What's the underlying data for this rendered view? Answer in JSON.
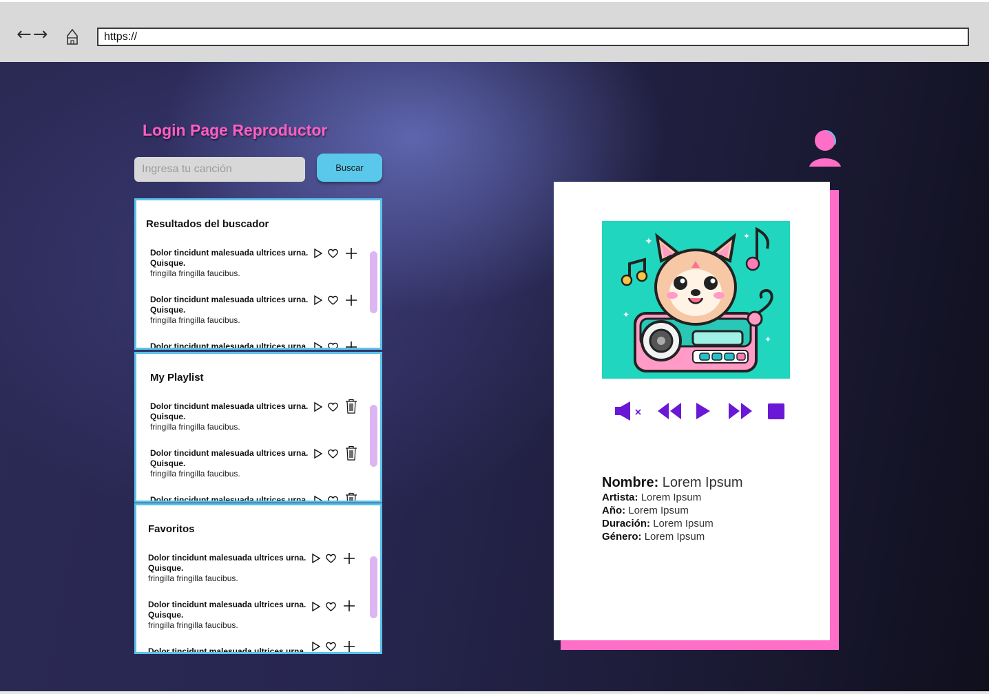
{
  "browser": {
    "nav_arrows": "←→",
    "url": "https://"
  },
  "page": {
    "title": "Login Page Reproductor"
  },
  "search": {
    "placeholder": "Ingresa tu canción",
    "button_label": "Buscar"
  },
  "results": {
    "title": "Resultados del buscador",
    "songs": [
      {
        "title": "Dolor tincidunt malesuada ultrices urna. Quisque.",
        "sub": "fringilla fringilla faucibus."
      },
      {
        "title": "Dolor tincidunt malesuada ultrices urna. Quisque.",
        "sub": "fringilla fringilla faucibus."
      },
      {
        "title": "Dolor tincidunt malesuada ultrices urna.",
        "sub": ""
      }
    ],
    "icons": [
      "play-icon",
      "heart-icon",
      "plus-icon"
    ]
  },
  "playlist": {
    "title": "My Playlist",
    "songs": [
      {
        "title": "Dolor tincidunt malesuada ultrices urna. Quisque.",
        "sub": "fringilla fringilla faucibus."
      },
      {
        "title": "Dolor tincidunt malesuada ultrices urna. Quisque.",
        "sub": "fringilla fringilla faucibus."
      },
      {
        "title": "Dolor tincidunt malesuada ultrices urna.",
        "sub": ""
      }
    ],
    "icons": [
      "play-icon",
      "heart-icon",
      "trash-icon"
    ]
  },
  "favorites": {
    "title": "Favoritos",
    "songs": [
      {
        "title": "Dolor tincidunt malesuada ultrices urna. Quisque.",
        "sub": "fringilla fringilla faucibus."
      },
      {
        "title": "Dolor tincidunt malesuada ultrices urna. Quisque.",
        "sub": "fringilla fringilla faucibus."
      },
      {
        "title": "Dolor tincidunt malesuada ultrices urna.",
        "sub": ""
      }
    ],
    "icons": [
      "play-icon",
      "heart-icon",
      "plus-icon"
    ]
  },
  "player": {
    "controls": [
      "mute-icon",
      "rewind-icon",
      "play-icon",
      "fast-forward-icon",
      "stop-icon"
    ],
    "info": {
      "nombre_label": "Nombre:",
      "nombre": "Lorem Ipsum",
      "artista_label": "Artista:",
      "artista": "Lorem Ipsum",
      "anio_label": "Año:",
      "anio": "Lorem Ipsum",
      "duracion_label": "Duración:",
      "duracion": "Lorem Ipsum",
      "genero_label": "Género:",
      "genero": "Lorem Ipsum"
    }
  },
  "colors": {
    "accent_pink": "#ff5ec4",
    "accent_blue": "#5ac8ea",
    "control_purple": "#6a18d6",
    "scrollbar": "#ddb5f3"
  }
}
